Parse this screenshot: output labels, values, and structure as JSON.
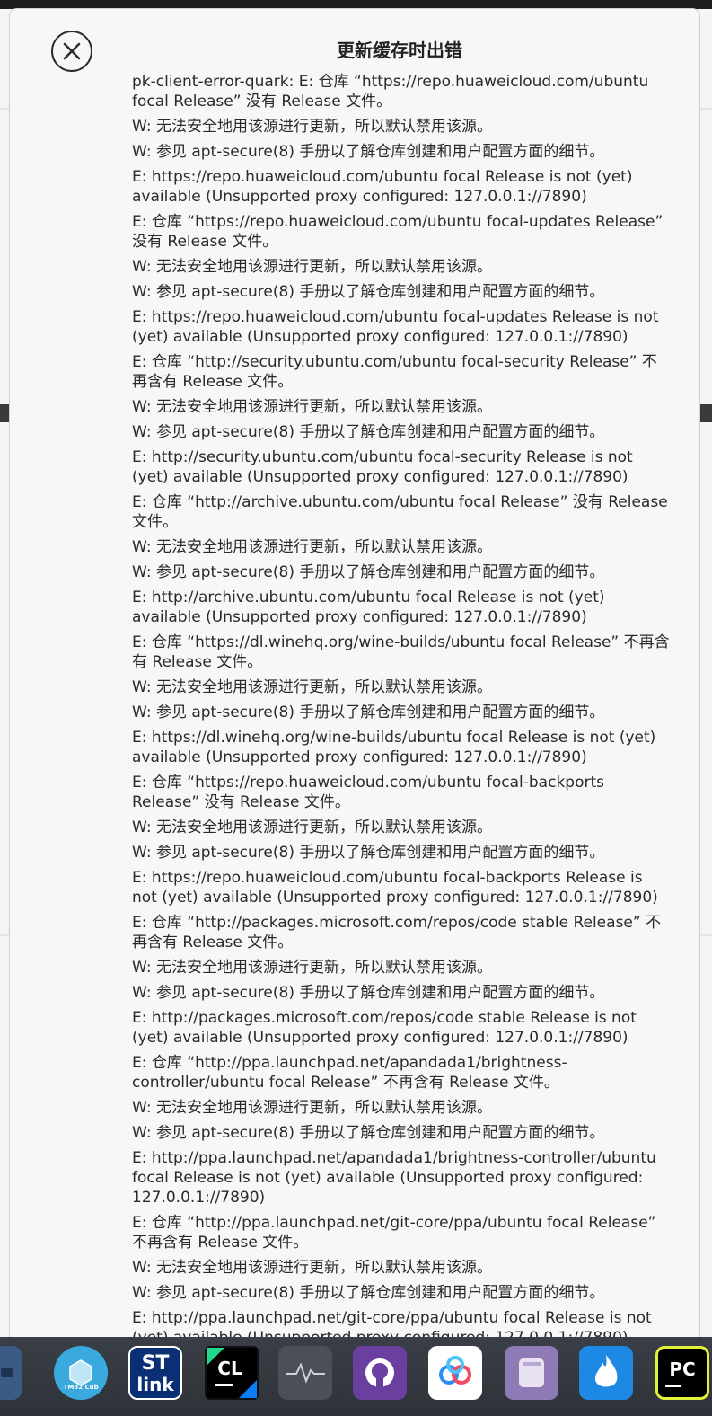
{
  "dialog": {
    "title": "更新缓存时出错",
    "messages": [
      "pk-client-error-quark: E: 仓库 “https://repo.huaweicloud.com/ubuntu focal Release” 没有 Release 文件。",
      "W: 无法安全地用该源进行更新，所以默认禁用该源。",
      "W: 参见 apt-secure(8) 手册以了解仓库创建和用户配置方面的细节。",
      "E: https://repo.huaweicloud.com/ubuntu focal Release is not (yet) available (Unsupported proxy configured: 127.0.0.1://7890)",
      "E: 仓库 “https://repo.huaweicloud.com/ubuntu focal-updates Release” 没有 Release 文件。",
      "W: 无法安全地用该源进行更新，所以默认禁用该源。",
      "W: 参见 apt-secure(8) 手册以了解仓库创建和用户配置方面的细节。",
      "E: https://repo.huaweicloud.com/ubuntu focal-updates Release is not (yet) available (Unsupported proxy configured: 127.0.0.1://7890)",
      "E: 仓库 “http://security.ubuntu.com/ubuntu focal-security Release” 不再含有 Release 文件。",
      "W: 无法安全地用该源进行更新，所以默认禁用该源。",
      "W: 参见 apt-secure(8) 手册以了解仓库创建和用户配置方面的细节。",
      "E: http://security.ubuntu.com/ubuntu focal-security Release is not (yet) available (Unsupported proxy configured: 127.0.0.1://7890)",
      "E: 仓库 “http://archive.ubuntu.com/ubuntu focal Release” 没有 Release 文件。",
      "W: 无法安全地用该源进行更新，所以默认禁用该源。",
      "W: 参见 apt-secure(8) 手册以了解仓库创建和用户配置方面的细节。",
      "E: http://archive.ubuntu.com/ubuntu focal Release is not (yet) available (Unsupported proxy configured: 127.0.0.1://7890)",
      "E: 仓库 “https://dl.winehq.org/wine-builds/ubuntu focal Release” 不再含有 Release 文件。",
      "W: 无法安全地用该源进行更新，所以默认禁用该源。",
      "W: 参见 apt-secure(8) 手册以了解仓库创建和用户配置方面的细节。",
      "E: https://dl.winehq.org/wine-builds/ubuntu focal Release is not (yet) available (Unsupported proxy configured: 127.0.0.1://7890)",
      "E: 仓库 “https://repo.huaweicloud.com/ubuntu focal-backports Release” 没有 Release 文件。",
      "W: 无法安全地用该源进行更新，所以默认禁用该源。",
      "W: 参见 apt-secure(8) 手册以了解仓库创建和用户配置方面的细节。",
      "E: https://repo.huaweicloud.com/ubuntu focal-backports Release is not (yet) available (Unsupported proxy configured: 127.0.0.1://7890)",
      "E: 仓库 “http://packages.microsoft.com/repos/code stable Release” 不再含有 Release 文件。",
      "W: 无法安全地用该源进行更新，所以默认禁用该源。",
      "W: 参见 apt-secure(8) 手册以了解仓库创建和用户配置方面的细节。",
      "E: http://packages.microsoft.com/repos/code stable Release is not (yet) available (Unsupported proxy configured: 127.0.0.1://7890)",
      "E: 仓库 “http://ppa.launchpad.net/apandada1/brightness-controller/ubuntu focal Release” 不再含有 Release 文件。",
      "W: 无法安全地用该源进行更新，所以默认禁用该源。",
      "W: 参见 apt-secure(8) 手册以了解仓库创建和用户配置方面的细节。",
      "E: http://ppa.launchpad.net/apandada1/brightness-controller/ubuntu focal Release is not (yet) available (Unsupported proxy configured: 127.0.0.1://7890)",
      "E: 仓库 “http://ppa.launchpad.net/git-core/ppa/ubuntu focal Release” 不再含有 Release 文件。",
      "W: 无法安全地用该源进行更新，所以默认禁用该源。",
      "W: 参见 apt-secure(8) 手册以了解仓库创建和用户配置方面的细节。",
      "E: http://ppa.launchpad.net/git-core/ppa/ubuntu focal Release is not (yet) available (Unsupported proxy configured: 127.0.0.1://7890)"
    ]
  },
  "dock": {
    "items": [
      {
        "label": "",
        "icon": "app-icon"
      },
      {
        "label": "STM32 Cube",
        "icon": "stm32cube-icon"
      },
      {
        "label": "ST link",
        "icon": "stlink-icon"
      },
      {
        "label": "CL",
        "icon": "clion-icon"
      },
      {
        "label": "",
        "icon": "system-monitor-icon"
      },
      {
        "label": "",
        "icon": "github-icon"
      },
      {
        "label": "",
        "icon": "baidu-netdisk-icon"
      },
      {
        "label": "",
        "icon": "motrix-icon"
      },
      {
        "label": "",
        "icon": "flame-icon"
      },
      {
        "label": "PC",
        "icon": "pycharm-icon"
      }
    ]
  }
}
